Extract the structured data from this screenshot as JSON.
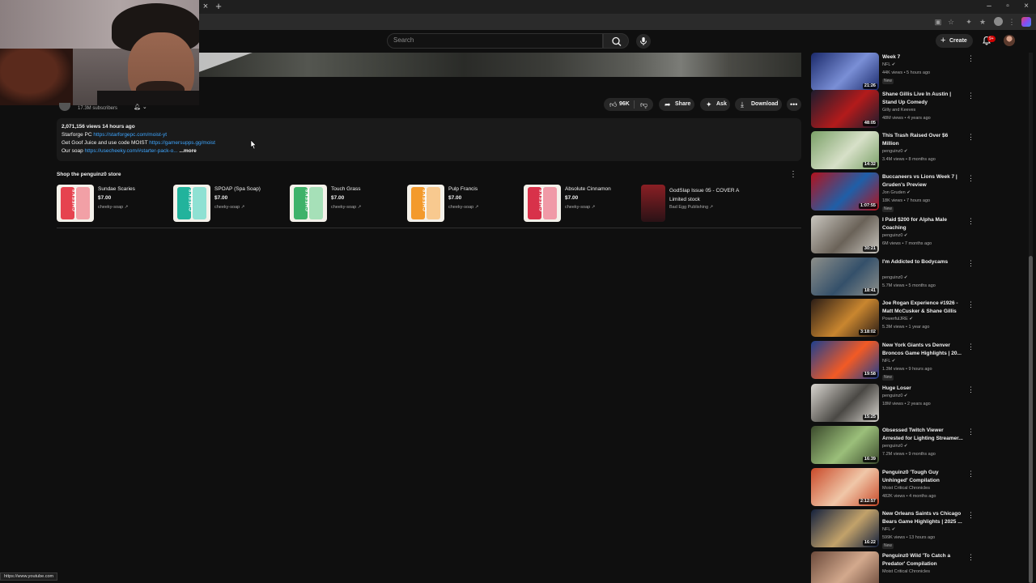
{
  "browser": {
    "tab_close": "×",
    "new_tab": "+",
    "window_controls": [
      "–",
      "▫",
      "×"
    ],
    "status_url": "https://www.youtube.com"
  },
  "topbar": {
    "search_placeholder": "Search",
    "create_label": "Create",
    "notifications_badge": "9+"
  },
  "channel": {
    "subscribers": "17.3M subscribers"
  },
  "actions": {
    "like_count": "96K",
    "share_label": "Share",
    "ask_label": "Ask",
    "download_label": "Download"
  },
  "description": {
    "meta": "2,071,156 views  14 hours ago",
    "line1_text": "Starforge PC ",
    "line1_link": "https://starforgepc.com/moist-yt",
    "line2_text": "Get Goof Juice and use code MOIST ",
    "line2_link": "https://gamersupps.gg/moist",
    "line3_text": "Our soap ",
    "line3_link": "https://usecheeky.com/#starter-pack-o...",
    "more_label": "...more"
  },
  "store": {
    "title": "Shop the penguinz0 store",
    "products": [
      {
        "name": "Sundae Scaries",
        "price": "$7.00",
        "seller": "cheeky-soap",
        "color": "#e6434f",
        "color2": "#f2a0a6"
      },
      {
        "name": "SPOAP (Spa Soap)",
        "price": "$7.00",
        "seller": "cheeky-soap",
        "color": "#22b39c",
        "color2": "#8fe1d3"
      },
      {
        "name": "Touch Grass",
        "price": "$7.00",
        "seller": "cheeky-soap",
        "color": "#3fb26a",
        "color2": "#a6e0b8"
      },
      {
        "name": "Pulp Francis",
        "price": "$7.00",
        "seller": "cheeky-soap",
        "color": "#f39a2c",
        "color2": "#f8c98f"
      },
      {
        "name": "Absolute Cinnamon",
        "price": "$7.00",
        "seller": "cheeky-soap",
        "color": "#d8324a",
        "color2": "#f09aa7"
      },
      {
        "name": "GodSlap Issue 05 - COVER A Limited stock",
        "price": "",
        "seller": "Bad Egg Publishing",
        "color": "#8a1f24",
        "color2": "#2a1216"
      }
    ],
    "product_logo": "CHEEKS"
  },
  "recommendations": [
    {
      "title": "Week 7",
      "channel": "NFL",
      "verified": true,
      "views": "44K views • 5 hours ago",
      "new": "New",
      "duration": "21:26",
      "thumb": [
        "#1b2a6b",
        "#7a8fd6"
      ]
    },
    {
      "title": "Shane Gillis Live In Austin | Stand Up Comedy",
      "channel": "Gilly and Keeves",
      "verified": false,
      "views": "48M views • 4 years ago",
      "new": "",
      "duration": "48:05",
      "thumb": [
        "#1c1c2e",
        "#b31b1b"
      ]
    },
    {
      "title": "This Trash Raised Over $6 Million",
      "channel": "penguinz0",
      "verified": true,
      "views": "3.4M views • 8 months ago",
      "new": "",
      "duration": "14:32",
      "thumb": [
        "#7aa067",
        "#d7e0c8"
      ]
    },
    {
      "title": "Buccaneers vs Lions Week 7 | Gruden's Preview",
      "channel": "Jon Gruden",
      "verified": true,
      "views": "18K views • 7 hours ago",
      "new": "New",
      "duration": "1:07:55",
      "thumb": [
        "#b3121c",
        "#1f5fa8"
      ]
    },
    {
      "title": "I Paid $200 for Alpha Male Coaching",
      "channel": "penguinz0",
      "verified": true,
      "views": "6M views • 7 months ago",
      "new": "",
      "duration": "30:21",
      "thumb": [
        "#c9c6bf",
        "#6a6258"
      ]
    },
    {
      "title": "I'm Addicted to Bodycams",
      "channel": "penguinz0",
      "verified": true,
      "views": "5.7M views • 5 months ago",
      "new": "",
      "duration": "18:41",
      "thumb": [
        "#8d8f8a",
        "#34506a"
      ]
    },
    {
      "title": "Joe Rogan Experience #1926 - Matt McCusker & Shane Gillis",
      "channel": "PowerfulJRE",
      "verified": true,
      "views": "5.3M views • 1 year ago",
      "new": "",
      "duration": "3:18:02",
      "thumb": [
        "#2b1d16",
        "#c9862f"
      ]
    },
    {
      "title": "New York Giants vs Denver Broncos Game Highlights | 20...",
      "channel": "NFL",
      "verified": true,
      "views": "1.3M views • 9 hours ago",
      "new": "New",
      "duration": "19:58",
      "thumb": [
        "#1d3f8f",
        "#f25a25"
      ]
    },
    {
      "title": "Huge Loser",
      "channel": "penguinz0",
      "verified": true,
      "views": "18M views • 2 years ago",
      "new": "",
      "duration": "15:25",
      "thumb": [
        "#d9d6d0",
        "#4a4844"
      ]
    },
    {
      "title": "Obsessed Twitch Viewer Arrested for Lighting Streamer...",
      "channel": "penguinz0",
      "verified": true,
      "views": "7.2M views • 9 months ago",
      "new": "",
      "duration": "16:39",
      "thumb": [
        "#3b4a2c",
        "#9bbf7a"
      ]
    },
    {
      "title": "Penguinz0 'Tough Guy Unhinged' Compilation",
      "channel": "Moist Critical Chronicles",
      "verified": false,
      "views": "482K views • 4 months ago",
      "new": "",
      "duration": "2:12:57",
      "thumb": [
        "#c94a2a",
        "#f0c7a8"
      ]
    },
    {
      "title": "New Orleans Saints vs Chicago Bears Game Highlights | 2025 ...",
      "channel": "NFL",
      "verified": true,
      "views": "599K views • 13 hours ago",
      "new": "New",
      "duration": "16:22",
      "thumb": [
        "#14213d",
        "#c2a26a"
      ]
    },
    {
      "title": "Penguinz0 Wild 'To Catch a Predator' Compilation",
      "channel": "Moist Critical Chronicles",
      "verified": false,
      "views": "",
      "new": "",
      "duration": "",
      "thumb": [
        "#6b4a3b",
        "#d3a98d"
      ]
    }
  ]
}
